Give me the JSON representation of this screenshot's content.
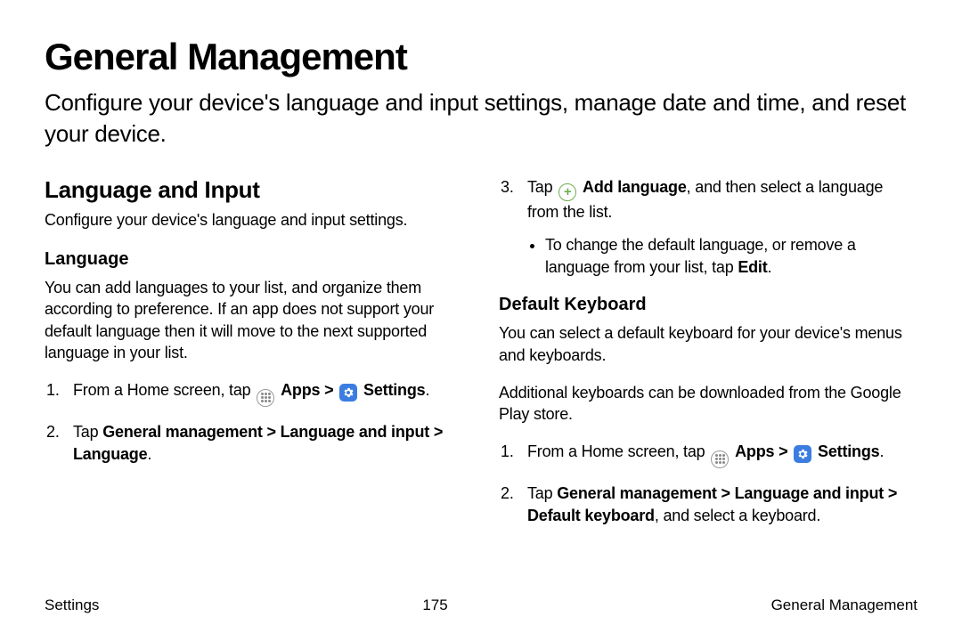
{
  "title": "General Management",
  "subtitle": "Configure your device's language and input settings, manage date and time, and reset your device.",
  "left": {
    "heading": "Language and Input",
    "desc": "Configure your device's language and input settings.",
    "sub1": {
      "heading": "Language",
      "paragraph": "You can add languages to your list, and organize them according to preference. If an app does not support your default language then it will move to the next supported language in your list.",
      "step1_prefix": "From a Home screen, tap ",
      "apps_label": "Apps",
      "settings_label": "Settings",
      "step2_a": "Tap ",
      "step2_b": "General management",
      "step2_c": "Language and input",
      "step2_d": "Language",
      "period": "."
    }
  },
  "right": {
    "step3_a": "Tap ",
    "step3_add": "Add language",
    "step3_b": ", and then select a language from the list.",
    "bullet_a": "To change the default language, or remove a language from your list, tap ",
    "bullet_edit": "Edit",
    "bullet_b": ".",
    "sub2": {
      "heading": "Default Keyboard",
      "p1": "You can select a default keyboard for your device's menus and keyboards.",
      "p2": "Additional keyboards can be downloaded from the Google Play store.",
      "step1_prefix": "From a Home screen, tap ",
      "apps_label": "Apps",
      "settings_label": "Settings",
      "step2_a": "Tap ",
      "step2_b": "General management",
      "step2_c": "Language and input",
      "step2_d": "Default keyboard",
      "step2_e": ", and select a keyboard."
    }
  },
  "footer": {
    "left": "Settings",
    "center": "175",
    "right": "General Management"
  },
  "chev": ">"
}
